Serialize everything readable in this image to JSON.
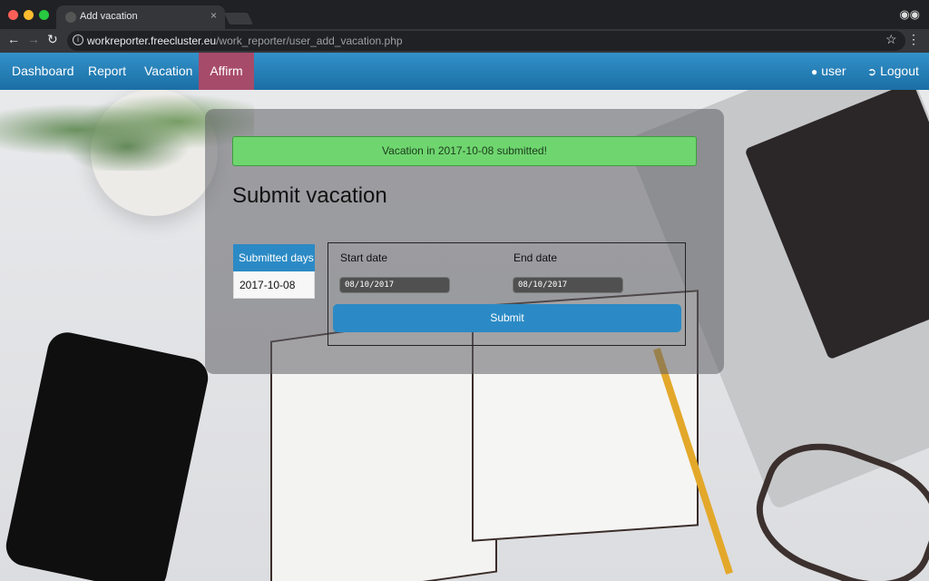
{
  "browser": {
    "tab_title": "Add vacation",
    "tab_close": "×",
    "url_host": "workreporter.freecluster.eu",
    "url_path": "/work_reporter/user_add_vacation.php",
    "icons": {
      "back": "back-arrow-icon",
      "forward": "forward-arrow-icon",
      "reload": "reload-icon",
      "info": "info-icon",
      "bookmark": "star-icon",
      "menu": "menu-icon",
      "incognito": "incognito-icon"
    }
  },
  "navbar": {
    "items": [
      {
        "label": "Dashboard"
      },
      {
        "label": "Report"
      },
      {
        "label": "Vacation"
      },
      {
        "label": "Affirm"
      }
    ],
    "user_label": "user",
    "logout_label": "Logout",
    "active_color": "#a74b6b",
    "bar_color": "#2283bd"
  },
  "main": {
    "alert": "Vacation in 2017-10-08 submitted!",
    "heading": "Submit vacation",
    "submitted_days": {
      "header": "Submitted days",
      "rows": [
        "2017-10-08"
      ]
    },
    "form": {
      "start_label": "Start date",
      "end_label": "End date",
      "start_value": "08/10/2017",
      "end_value": "08/10/2017",
      "submit_label": "Submit"
    }
  }
}
